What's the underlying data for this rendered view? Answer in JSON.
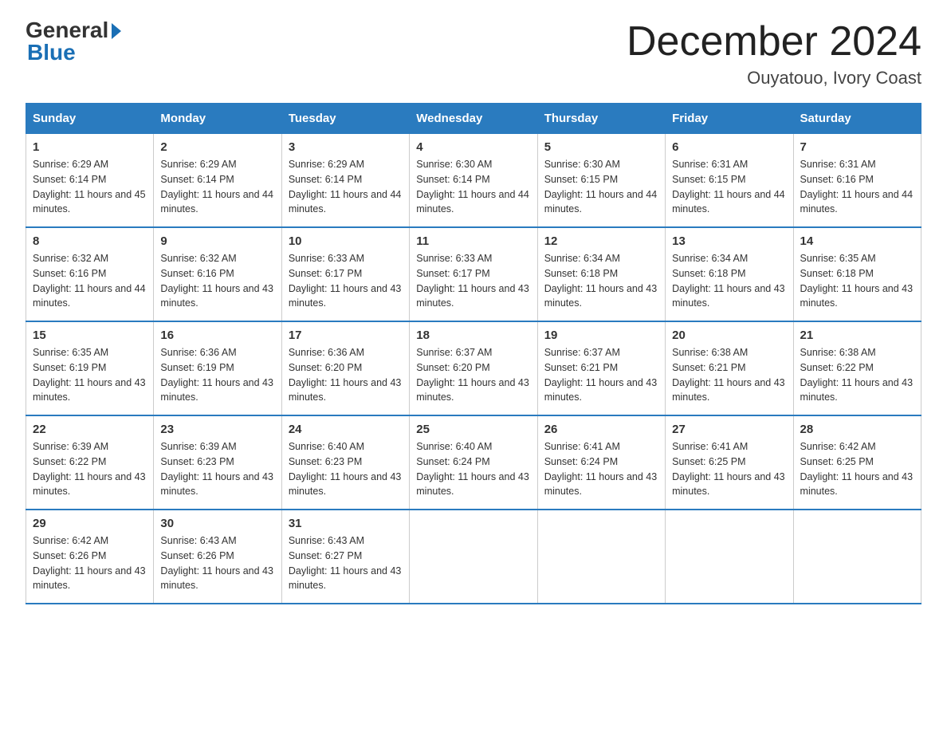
{
  "logo": {
    "general": "General",
    "arrow": "",
    "blue": "Blue"
  },
  "title": "December 2024",
  "location": "Ouyatouo, Ivory Coast",
  "days_of_week": [
    "Sunday",
    "Monday",
    "Tuesday",
    "Wednesday",
    "Thursday",
    "Friday",
    "Saturday"
  ],
  "weeks": [
    [
      {
        "day": 1,
        "sunrise": "6:29 AM",
        "sunset": "6:14 PM",
        "daylight": "11 hours and 45 minutes."
      },
      {
        "day": 2,
        "sunrise": "6:29 AM",
        "sunset": "6:14 PM",
        "daylight": "11 hours and 44 minutes."
      },
      {
        "day": 3,
        "sunrise": "6:29 AM",
        "sunset": "6:14 PM",
        "daylight": "11 hours and 44 minutes."
      },
      {
        "day": 4,
        "sunrise": "6:30 AM",
        "sunset": "6:14 PM",
        "daylight": "11 hours and 44 minutes."
      },
      {
        "day": 5,
        "sunrise": "6:30 AM",
        "sunset": "6:15 PM",
        "daylight": "11 hours and 44 minutes."
      },
      {
        "day": 6,
        "sunrise": "6:31 AM",
        "sunset": "6:15 PM",
        "daylight": "11 hours and 44 minutes."
      },
      {
        "day": 7,
        "sunrise": "6:31 AM",
        "sunset": "6:16 PM",
        "daylight": "11 hours and 44 minutes."
      }
    ],
    [
      {
        "day": 8,
        "sunrise": "6:32 AM",
        "sunset": "6:16 PM",
        "daylight": "11 hours and 44 minutes."
      },
      {
        "day": 9,
        "sunrise": "6:32 AM",
        "sunset": "6:16 PM",
        "daylight": "11 hours and 43 minutes."
      },
      {
        "day": 10,
        "sunrise": "6:33 AM",
        "sunset": "6:17 PM",
        "daylight": "11 hours and 43 minutes."
      },
      {
        "day": 11,
        "sunrise": "6:33 AM",
        "sunset": "6:17 PM",
        "daylight": "11 hours and 43 minutes."
      },
      {
        "day": 12,
        "sunrise": "6:34 AM",
        "sunset": "6:18 PM",
        "daylight": "11 hours and 43 minutes."
      },
      {
        "day": 13,
        "sunrise": "6:34 AM",
        "sunset": "6:18 PM",
        "daylight": "11 hours and 43 minutes."
      },
      {
        "day": 14,
        "sunrise": "6:35 AM",
        "sunset": "6:18 PM",
        "daylight": "11 hours and 43 minutes."
      }
    ],
    [
      {
        "day": 15,
        "sunrise": "6:35 AM",
        "sunset": "6:19 PM",
        "daylight": "11 hours and 43 minutes."
      },
      {
        "day": 16,
        "sunrise": "6:36 AM",
        "sunset": "6:19 PM",
        "daylight": "11 hours and 43 minutes."
      },
      {
        "day": 17,
        "sunrise": "6:36 AM",
        "sunset": "6:20 PM",
        "daylight": "11 hours and 43 minutes."
      },
      {
        "day": 18,
        "sunrise": "6:37 AM",
        "sunset": "6:20 PM",
        "daylight": "11 hours and 43 minutes."
      },
      {
        "day": 19,
        "sunrise": "6:37 AM",
        "sunset": "6:21 PM",
        "daylight": "11 hours and 43 minutes."
      },
      {
        "day": 20,
        "sunrise": "6:38 AM",
        "sunset": "6:21 PM",
        "daylight": "11 hours and 43 minutes."
      },
      {
        "day": 21,
        "sunrise": "6:38 AM",
        "sunset": "6:22 PM",
        "daylight": "11 hours and 43 minutes."
      }
    ],
    [
      {
        "day": 22,
        "sunrise": "6:39 AM",
        "sunset": "6:22 PM",
        "daylight": "11 hours and 43 minutes."
      },
      {
        "day": 23,
        "sunrise": "6:39 AM",
        "sunset": "6:23 PM",
        "daylight": "11 hours and 43 minutes."
      },
      {
        "day": 24,
        "sunrise": "6:40 AM",
        "sunset": "6:23 PM",
        "daylight": "11 hours and 43 minutes."
      },
      {
        "day": 25,
        "sunrise": "6:40 AM",
        "sunset": "6:24 PM",
        "daylight": "11 hours and 43 minutes."
      },
      {
        "day": 26,
        "sunrise": "6:41 AM",
        "sunset": "6:24 PM",
        "daylight": "11 hours and 43 minutes."
      },
      {
        "day": 27,
        "sunrise": "6:41 AM",
        "sunset": "6:25 PM",
        "daylight": "11 hours and 43 minutes."
      },
      {
        "day": 28,
        "sunrise": "6:42 AM",
        "sunset": "6:25 PM",
        "daylight": "11 hours and 43 minutes."
      }
    ],
    [
      {
        "day": 29,
        "sunrise": "6:42 AM",
        "sunset": "6:26 PM",
        "daylight": "11 hours and 43 minutes."
      },
      {
        "day": 30,
        "sunrise": "6:43 AM",
        "sunset": "6:26 PM",
        "daylight": "11 hours and 43 minutes."
      },
      {
        "day": 31,
        "sunrise": "6:43 AM",
        "sunset": "6:27 PM",
        "daylight": "11 hours and 43 minutes."
      },
      null,
      null,
      null,
      null
    ]
  ]
}
